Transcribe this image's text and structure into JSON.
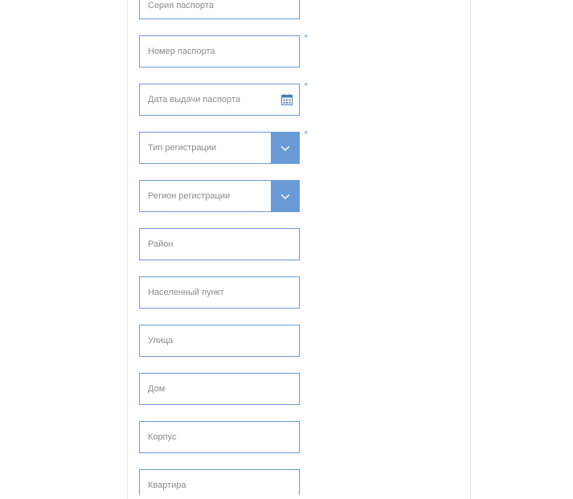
{
  "fields": {
    "passport_series": {
      "label": "Серия паспорта",
      "required": false
    },
    "passport_number": {
      "label": "Номер паспорта",
      "required": true
    },
    "passport_date": {
      "label": "Дата выдачи паспорта",
      "required": true
    },
    "reg_type": {
      "label": "Тип регистрации",
      "required": true
    },
    "reg_region": {
      "label": "Регион регистрации",
      "required": false
    },
    "district": {
      "label": "Район",
      "required": false
    },
    "locality": {
      "label": "Населенный пункт",
      "required": false
    },
    "street": {
      "label": "Улица",
      "required": false
    },
    "house": {
      "label": "Дом",
      "required": false
    },
    "building": {
      "label": "Корпус",
      "required": false
    },
    "apartment": {
      "label": "Квартира",
      "required": false
    }
  },
  "required_mark": "*"
}
